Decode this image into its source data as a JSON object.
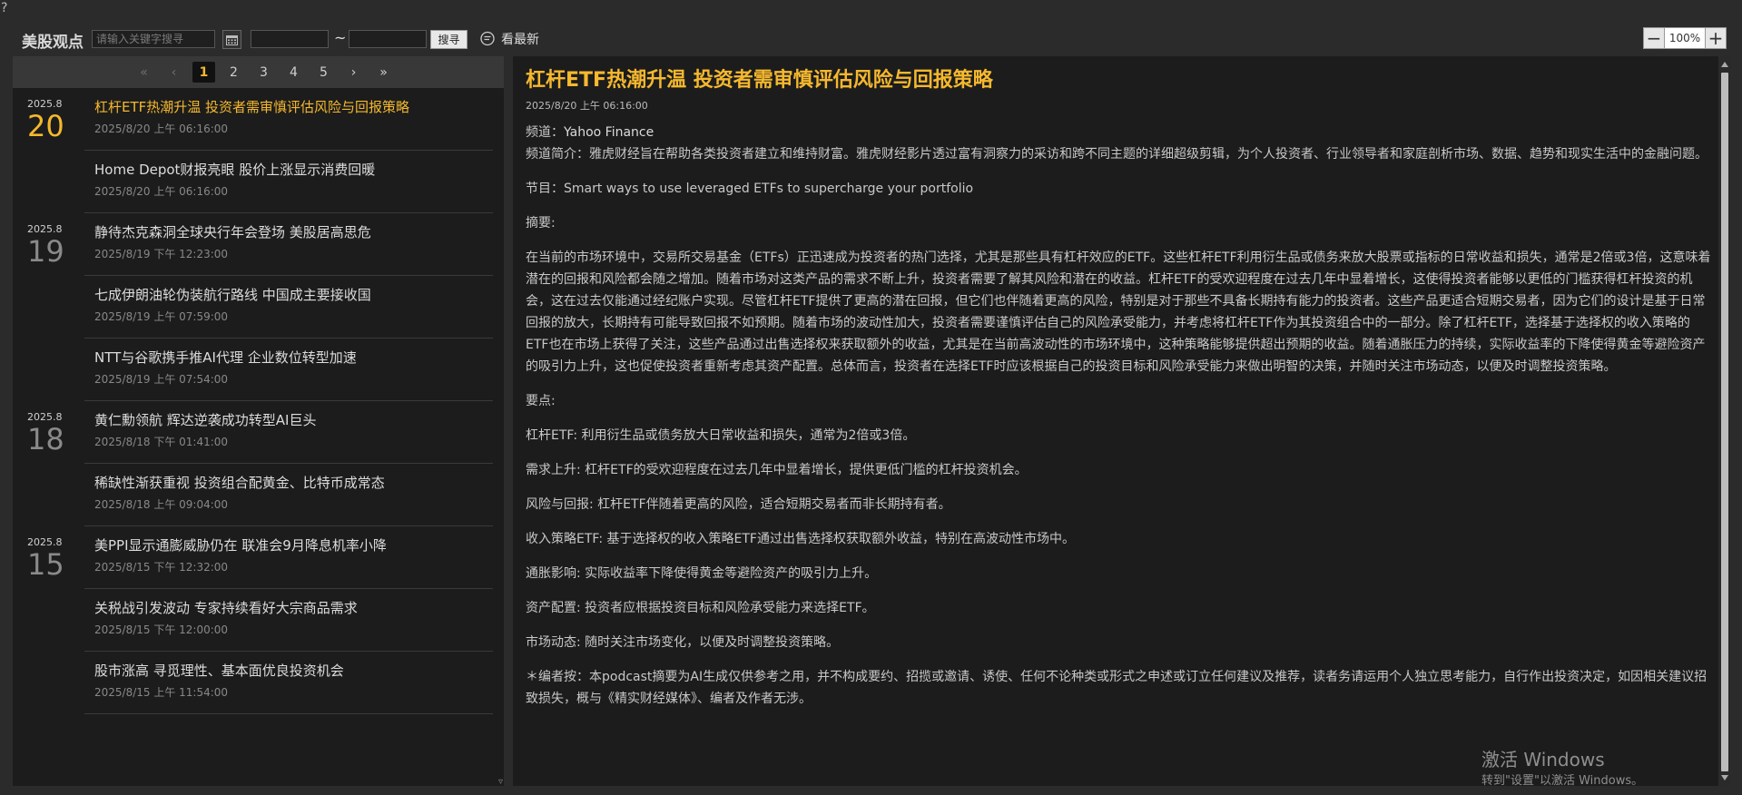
{
  "help_mark": "?",
  "toolbar": {
    "brand": "美股观点",
    "search_placeholder": "请输入关键字搜寻",
    "date_from": "",
    "date_to": "",
    "tilde": "~",
    "search_button": "搜寻",
    "latest_button": "看最新",
    "zoom_minus": "−",
    "zoom_value": "100%",
    "zoom_plus": "+"
  },
  "pager": {
    "first": "«",
    "prev": "‹",
    "pages": [
      "1",
      "2",
      "3",
      "4",
      "5"
    ],
    "active_page": "1",
    "next": "›",
    "last": "»"
  },
  "news": [
    {
      "month": "2025.8",
      "day": "20",
      "title": "杠杆ETF热潮升温 投资者需审慎评估风险与回报策略",
      "time": "2025/8/20 上午 06:16:00",
      "active": true
    },
    {
      "month": "",
      "day": "",
      "title": "Home Depot财报亮眼 股价上涨显示消费回暖",
      "time": "2025/8/20 上午 06:16:00",
      "active": false
    },
    {
      "month": "2025.8",
      "day": "19",
      "title": "静待杰克森洞全球央行年会登场 美股居高思危",
      "time": "2025/8/19 下午 12:23:00",
      "active": false
    },
    {
      "month": "",
      "day": "",
      "title": "七成伊朗油轮伪装航行路线 中国成主要接收国",
      "time": "2025/8/19 上午 07:59:00",
      "active": false
    },
    {
      "month": "",
      "day": "",
      "title": "NTT与谷歌携手推AI代理 企业数位转型加速",
      "time": "2025/8/19 上午 07:54:00",
      "active": false
    },
    {
      "month": "2025.8",
      "day": "18",
      "title": "黄仁勳领航 辉达逆袭成功转型AI巨头",
      "time": "2025/8/18 下午 01:41:00",
      "active": false
    },
    {
      "month": "",
      "day": "",
      "title": "稀缺性渐获重视 投资组合配黄金、比特币成常态",
      "time": "2025/8/18 上午 09:04:00",
      "active": false
    },
    {
      "month": "2025.8",
      "day": "15",
      "title": "美PPI显示通膨威胁仍在 联准会9月降息机率小降",
      "time": "2025/8/15 下午 12:32:00",
      "active": false
    },
    {
      "month": "",
      "day": "",
      "title": "关税战引发波动 专家持续看好大宗商品需求",
      "time": "2025/8/15 下午 12:00:00",
      "active": false
    },
    {
      "month": "",
      "day": "",
      "title": "股市涨高 寻觅理性、基本面优良投资机会",
      "time": "2025/8/15 上午 11:54:00",
      "active": false
    }
  ],
  "article": {
    "title": "杠杆ETF热潮升温 投资者需审慎评估风险与回报策略",
    "time": "2025/8/20 上午 06:16:00",
    "channel_label": "频道：",
    "channel_name": "Yahoo Finance",
    "channel_intro": "频道简介：雅虎财经旨在帮助各类投资者建立和维持财富。雅虎财经影片透过富有洞察力的采访和跨不同主题的详细超级剪辑，为个人投资者、行业领导者和家庭剖析市场、数据、趋势和现实生活中的金融问题。",
    "program": "节目：Smart ways to use leveraged ETFs to supercharge your portfolio",
    "summary_label": "摘要:",
    "summary": "在当前的市场环境中，交易所交易基金（ETFs）正迅速成为投资者的热门选择，尤其是那些具有杠杆效应的ETF。这些杠杆ETF利用衍生品或债务来放大股票或指标的日常收益和损失，通常是2倍或3倍，这意味着潜在的回报和风险都会随之增加。随着市场对这类产品的需求不断上升，投资者需要了解其风险和潜在的收益。杠杆ETF的受欢迎程度在过去几年中显着增长，这使得投资者能够以更低的门槛获得杠杆投资的机会，这在过去仅能通过经纪账户实现。尽管杠杆ETF提供了更高的潜在回报，但它们也伴随着更高的风险，特别是对于那些不具备长期持有能力的投资者。这些产品更适合短期交易者，因为它们的设计是基于日常回报的放大，长期持有可能导致回报不如预期。随着市场的波动性加大，投资者需要谨慎评估自己的风险承受能力，并考虑将杠杆ETF作为其投资组合中的一部分。除了杠杆ETF，选择基于选择权的收入策略的ETF也在市场上获得了关注，这些产品通过出售选择权来获取额外的收益，尤其是在当前高波动性的市场环境中，这种策略能够提供超出预期的收益。随着通胀压力的持续，实际收益率的下降使得黄金等避险资产的吸引力上升，这也促使投资者重新考虑其资产配置。总体而言，投资者在选择ETF时应该根据自己的投资目标和风险承受能力来做出明智的决策，并随时关注市场动态，以便及时调整投资策略。",
    "points_label": "要点:",
    "points": [
      "杠杆ETF: 利用衍生品或债务放大日常收益和损失，通常为2倍或3倍。",
      "需求上升: 杠杆ETF的受欢迎程度在过去几年中显着增长，提供更低门槛的杠杆投资机会。",
      "风险与回报: 杠杆ETF伴随着更高的风险，适合短期交易者而非长期持有者。",
      "收入策略ETF: 基于选择权的收入策略ETF通过出售选择权获取额外收益，特别在高波动性市场中。",
      "通胀影响: 实际收益率下降使得黄金等避险资产的吸引力上升。",
      "资产配置: 投资者应根据投资目标和风险承受能力来选择ETF。",
      "市场动态: 随时关注市场变化，以便及时调整投资策略。"
    ],
    "editor_note": "＊编者按：本podcast摘要为AI生成仅供参考之用，并不构成要约、招揽或邀请、诱使、任何不论种类或形式之申述或订立任何建议及推荐，读者务请运用个人独立思考能力，自行作出投资决定，如因相关建议招致损失，概与《精实财经媒体》、编者及作者无涉。"
  },
  "watermark": {
    "title": "激活 Windows",
    "subtitle": "转到\"设置\"以激活 Windows。"
  },
  "left_scroll_mark": "▿"
}
